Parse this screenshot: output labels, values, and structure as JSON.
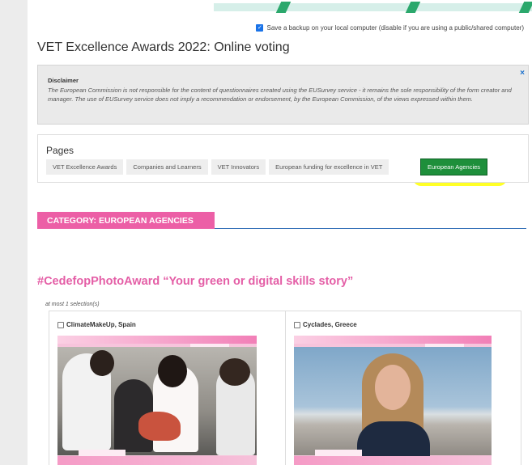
{
  "header": {
    "backup_label": "Save a backup on your local computer (disable if you are using a public/shared computer)",
    "survey_title": "VET Excellence Awards 2022: Online voting"
  },
  "disclaimer": {
    "title": "Disclaimer",
    "text": "The European Commission is not responsible for the content of questionnaires created using the EUSurvey service - it remains the sole responsibility of the form creator and manager. The use of EUSurvey service does not imply a recommendation or endorsement, by the European Commission, of the views expressed within them.",
    "close_glyph": "×"
  },
  "pages": {
    "title": "Pages",
    "tabs": [
      {
        "label": "VET Excellence Awards"
      },
      {
        "label": "Companies and Learners"
      },
      {
        "label": "VET Innovators"
      },
      {
        "label": "European funding for excellence in VET"
      },
      {
        "label": "European Agencies"
      }
    ],
    "active_index": 4
  },
  "category": {
    "label": "CATEGORY: EUROPEAN AGENCIES"
  },
  "question": {
    "title": "#CedefopPhotoAward “Your green or digital skills story”",
    "hint": "at most 1 selection(s)",
    "answers": [
      {
        "label": "ClimateMakeUp, Spain"
      },
      {
        "label": "Cyclades, Greece"
      }
    ]
  },
  "colors": {
    "accent_pink": "#ec5fa6",
    "active_tab_green": "#1e8f3b",
    "highlight_yellow": "#ffff00",
    "link_blue": "#1a6fcc"
  }
}
